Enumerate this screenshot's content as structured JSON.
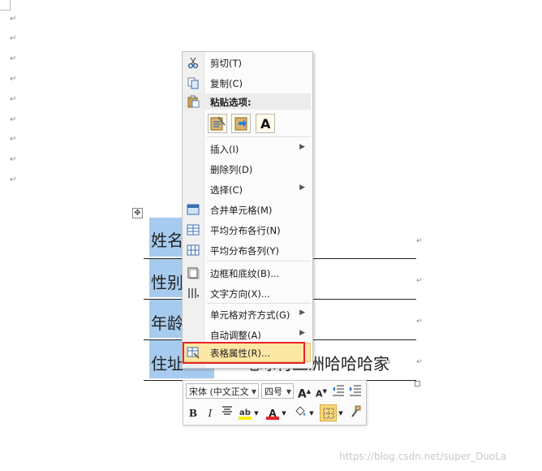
{
  "paragraph_mark": "↵",
  "table": {
    "rows": [
      {
        "label": "姓名"
      },
      {
        "label": "性别"
      },
      {
        "label": "年龄"
      },
      {
        "label": "住址",
        "value": "地球村亚洲哈哈哈家"
      }
    ]
  },
  "context_menu": {
    "cut": "剪切(T)",
    "copy": "复制(C)",
    "paste_options_title": "粘贴选项:",
    "insert": "插入(I)",
    "delete_column": "删除列(D)",
    "select": "选择(C)",
    "merge_cells": "合并单元格(M)",
    "distribute_rows": "平均分布各行(N)",
    "distribute_columns": "平均分布各列(Y)",
    "borders_shading": "边框和底纹(B)...",
    "text_direction": "文字方向(X)...",
    "cell_alignment": "单元格对齐方式(G)",
    "autofit": "自动调整(A)",
    "table_properties": "表格属性(R)..."
  },
  "mini_toolbar": {
    "font_name": "宋体 (中文正文",
    "font_size": "四号",
    "grow_font": "A",
    "shrink_font": "A",
    "bold": "B",
    "italic": "I",
    "font_color_glyph": "A",
    "highlight_glyph": "ab"
  },
  "watermark": "https://blog.csdn.net/super_DuoLa",
  "colors": {
    "selection": "#a7cbee",
    "highlight_item": "#fde7a4",
    "red_outline": "#e8242a"
  }
}
